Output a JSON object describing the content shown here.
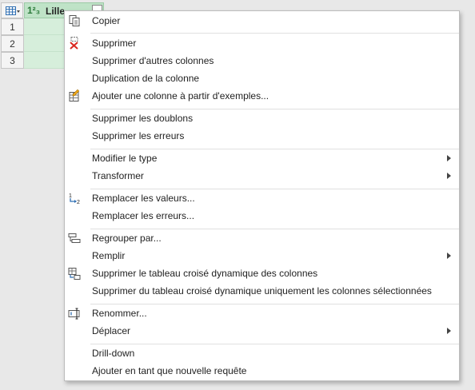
{
  "grid": {
    "column": {
      "type_label": "1²₃",
      "name": "Lille"
    },
    "rows": [
      "1",
      "2",
      "3"
    ]
  },
  "menu": {
    "items": [
      {
        "label": "Copier",
        "icon": "copy-icon"
      },
      {
        "label": "Supprimer",
        "icon": "remove-column-icon"
      },
      {
        "label": "Supprimer d'autres colonnes"
      },
      {
        "label": "Duplication de la colonne"
      },
      {
        "label": "Ajouter une colonne à partir d'exemples...",
        "icon": "column-from-examples-icon"
      },
      {
        "label": "Supprimer les doublons"
      },
      {
        "label": "Supprimer les erreurs"
      },
      {
        "label": "Modifier le type",
        "submenu": true
      },
      {
        "label": "Transformer",
        "submenu": true
      },
      {
        "label": "Remplacer les valeurs...",
        "icon": "replace-values-icon"
      },
      {
        "label": "Remplacer les erreurs..."
      },
      {
        "label": "Regrouper par...",
        "icon": "group-by-icon"
      },
      {
        "label": "Remplir",
        "submenu": true
      },
      {
        "label": "Supprimer le tableau croisé dynamique des colonnes",
        "icon": "unpivot-icon"
      },
      {
        "label": "Supprimer du tableau croisé dynamique uniquement les colonnes sélectionnées"
      },
      {
        "label": "Renommer...",
        "icon": "rename-icon"
      },
      {
        "label": "Déplacer",
        "submenu": true
      },
      {
        "label": "Drill-down"
      },
      {
        "label": "Ajouter en tant que nouvelle requête"
      }
    ]
  },
  "colors": {
    "selected_header": "#bfe3c7",
    "selected_cell": "#d6eedb",
    "delete_red": "#d9251d",
    "icon_blue": "#2f6fb3"
  }
}
